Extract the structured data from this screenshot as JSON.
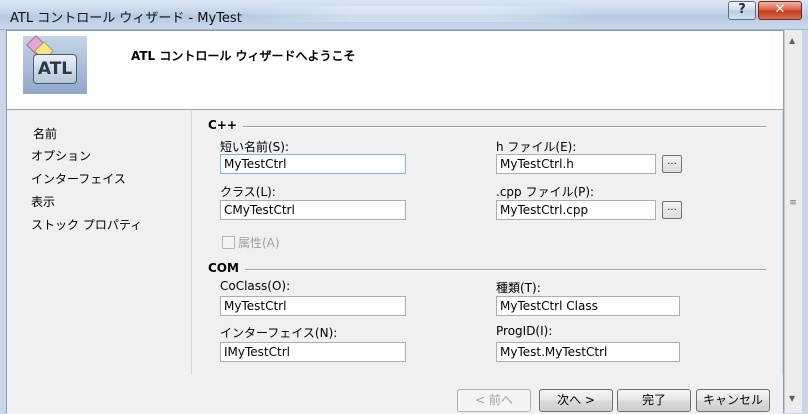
{
  "window": {
    "title": "ATL コントロール ウィザード - MyTest",
    "help_label": "?",
    "close_label": "✕"
  },
  "header": {
    "logo_text": "ATL",
    "title": "ATL コントロール ウィザードへようこそ"
  },
  "nav": {
    "items": [
      {
        "label": "名前",
        "selected": true
      },
      {
        "label": "オプション"
      },
      {
        "label": "インターフェイス"
      },
      {
        "label": "表示"
      },
      {
        "label": "ストック プロパティ"
      }
    ]
  },
  "cpp": {
    "group_title": "C++",
    "short_name_label": "短い名前(S):",
    "short_name_value": "MyTestCtrl",
    "h_file_label": "h ファイル(E):",
    "h_file_value": "MyTestCtrl.h",
    "class_label": "クラス(L):",
    "class_value": "CMyTestCtrl",
    "cpp_file_label": ".cpp ファイル(P):",
    "cpp_file_value": "MyTestCtrl.cpp",
    "browse_label": "...",
    "attributed_label": "属性(A)"
  },
  "com": {
    "group_title": "COM",
    "coclass_label": "CoClass(O):",
    "coclass_value": "MyTestCtrl",
    "type_label": "種類(T):",
    "type_value": "MyTestCtrl Class",
    "interface_label": "インターフェイス(N):",
    "interface_value": "IMyTestCtrl",
    "progid_label": "ProgID(I):",
    "progid_value": "MyTest.MyTestCtrl"
  },
  "buttons": {
    "back": "< 前へ",
    "next": "次へ >",
    "finish": "完了",
    "cancel": "キャンセル"
  }
}
